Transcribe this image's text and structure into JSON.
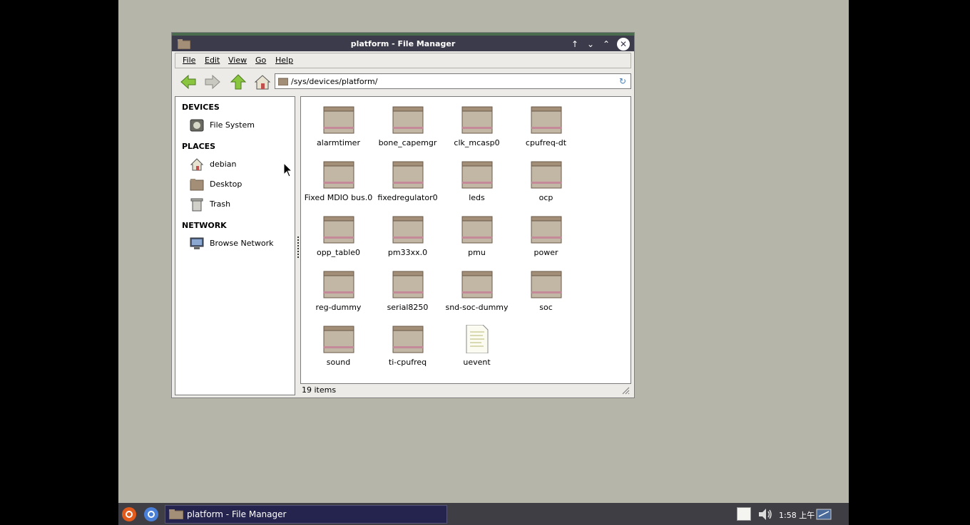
{
  "window": {
    "title": "platform - File Manager"
  },
  "menu": {
    "items": [
      "File",
      "Edit",
      "View",
      "Go",
      "Help"
    ]
  },
  "toolbar": {
    "path": "/sys/devices/platform/"
  },
  "sidebar": {
    "devices_header": "DEVICES",
    "places_header": "PLACES",
    "network_header": "NETWORK",
    "devices": [
      {
        "label": "File System",
        "icon": "drive-icon"
      }
    ],
    "places": [
      {
        "label": "debian",
        "icon": "home-icon"
      },
      {
        "label": "Desktop",
        "icon": "desktop-icon"
      },
      {
        "label": "Trash",
        "icon": "trash-icon"
      }
    ],
    "network": [
      {
        "label": "Browse Network",
        "icon": "network-icon"
      }
    ]
  },
  "files": [
    {
      "name": "alarmtimer",
      "type": "folder"
    },
    {
      "name": "bone_capemgr",
      "type": "folder"
    },
    {
      "name": "clk_mcasp0",
      "type": "folder"
    },
    {
      "name": "cpufreq-dt",
      "type": "folder"
    },
    {
      "name": "Fixed MDIO bus.0",
      "type": "folder"
    },
    {
      "name": "fixedregulator0",
      "type": "folder"
    },
    {
      "name": "leds",
      "type": "folder"
    },
    {
      "name": "ocp",
      "type": "folder"
    },
    {
      "name": "opp_table0",
      "type": "folder"
    },
    {
      "name": "pm33xx.0",
      "type": "folder"
    },
    {
      "name": "pmu",
      "type": "folder"
    },
    {
      "name": "power",
      "type": "folder"
    },
    {
      "name": "reg-dummy",
      "type": "folder"
    },
    {
      "name": "serial8250",
      "type": "folder"
    },
    {
      "name": "snd-soc-dummy",
      "type": "folder"
    },
    {
      "name": "soc",
      "type": "folder"
    },
    {
      "name": "sound",
      "type": "folder"
    },
    {
      "name": "ti-cpufreq",
      "type": "folder"
    },
    {
      "name": "uevent",
      "type": "file"
    }
  ],
  "status": {
    "text": "19 items"
  },
  "taskbar": {
    "window_label": "platform - File Manager",
    "clock": "1:58 上午"
  },
  "colors": {
    "titlebar": "#3c3b4b",
    "desktop": "#b5b5a9",
    "taskbar": "#3e3e44",
    "folder": "#a38f78"
  }
}
